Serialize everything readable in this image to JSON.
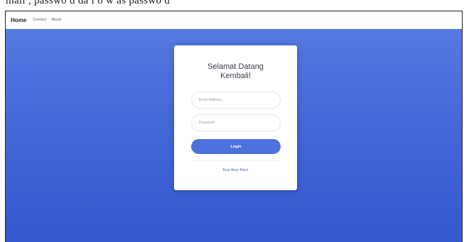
{
  "caption": {
    "text": "mail , passwo  d da   l  o  w  as  passwo  d"
  },
  "navbar": {
    "home_label": "Home",
    "links": [
      {
        "label": "Contact"
      },
      {
        "label": "About"
      }
    ]
  },
  "login_card": {
    "title_line1": "Selamat Datang",
    "title_line2": "Kembali!",
    "email_placeholder": "Email Address...",
    "password_placeholder": "Password",
    "login_button_label": "Login",
    "create_account_link": "Buat Akun Baru!"
  },
  "colors": {
    "hero_top": "#5579e0",
    "hero_bottom": "#3458cd",
    "login_button": "#4d72dc",
    "link": "#5a6bd6"
  }
}
